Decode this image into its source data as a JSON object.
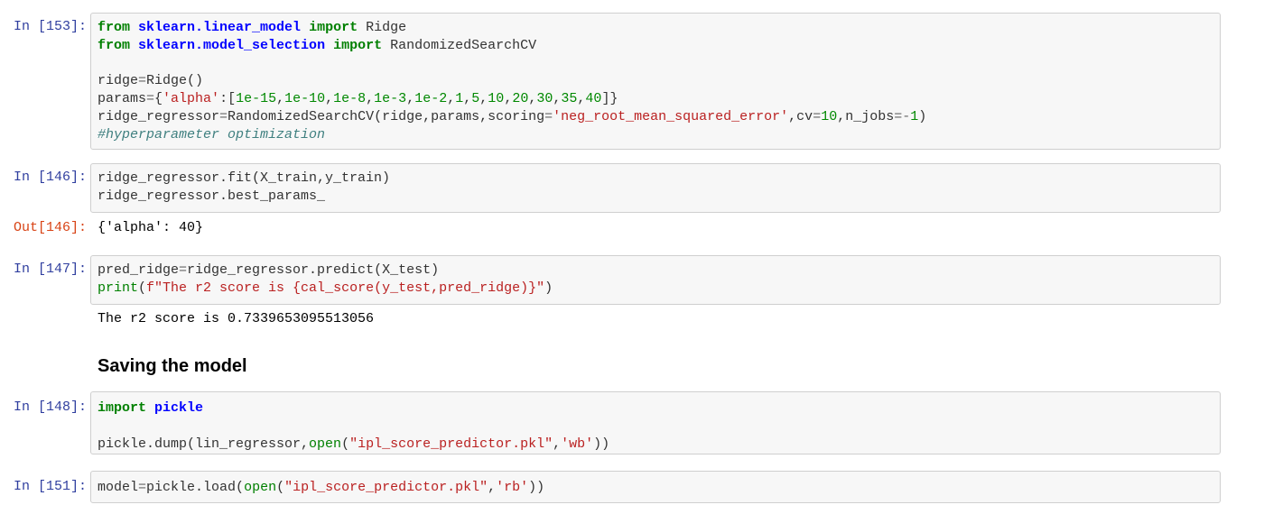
{
  "notebook": {
    "cells": [
      {
        "type": "code",
        "prompt": "In [153]:",
        "lines": [
          [
            {
              "t": "from",
              "c": "k"
            },
            {
              "t": " "
            },
            {
              "t": "sklearn.linear_model",
              "c": "nn"
            },
            {
              "t": " "
            },
            {
              "t": "import",
              "c": "k"
            },
            {
              "t": " Ridge"
            }
          ],
          [
            {
              "t": "from",
              "c": "k"
            },
            {
              "t": " "
            },
            {
              "t": "sklearn.model_selection",
              "c": "nn"
            },
            {
              "t": " "
            },
            {
              "t": "import",
              "c": "k"
            },
            {
              "t": " RandomizedSearchCV"
            }
          ],
          [],
          [
            {
              "t": "ridge"
            },
            {
              "t": "=",
              "c": "o"
            },
            {
              "t": "Ridge()"
            }
          ],
          [
            {
              "t": "params"
            },
            {
              "t": "=",
              "c": "o"
            },
            {
              "t": "{"
            },
            {
              "t": "'alpha'",
              "c": "s"
            },
            {
              "t": ":["
            },
            {
              "t": "1e-15",
              "c": "m"
            },
            {
              "t": ","
            },
            {
              "t": "1e-10",
              "c": "m"
            },
            {
              "t": ","
            },
            {
              "t": "1e-8",
              "c": "m"
            },
            {
              "t": ","
            },
            {
              "t": "1e-3",
              "c": "m"
            },
            {
              "t": ","
            },
            {
              "t": "1e-2",
              "c": "m"
            },
            {
              "t": ","
            },
            {
              "t": "1",
              "c": "m"
            },
            {
              "t": ","
            },
            {
              "t": "5",
              "c": "m"
            },
            {
              "t": ","
            },
            {
              "t": "10",
              "c": "m"
            },
            {
              "t": ","
            },
            {
              "t": "20",
              "c": "m"
            },
            {
              "t": ","
            },
            {
              "t": "30",
              "c": "m"
            },
            {
              "t": ","
            },
            {
              "t": "35",
              "c": "m"
            },
            {
              "t": ","
            },
            {
              "t": "40",
              "c": "m"
            },
            {
              "t": "]}"
            }
          ],
          [
            {
              "t": "ridge_regressor"
            },
            {
              "t": "=",
              "c": "o"
            },
            {
              "t": "RandomizedSearchCV(ridge,params,scoring"
            },
            {
              "t": "=",
              "c": "o"
            },
            {
              "t": "'neg_root_mean_squared_error'",
              "c": "s"
            },
            {
              "t": ",cv"
            },
            {
              "t": "=",
              "c": "o"
            },
            {
              "t": "10",
              "c": "m"
            },
            {
              "t": ",n_jobs"
            },
            {
              "t": "=-",
              "c": "o"
            },
            {
              "t": "1",
              "c": "m"
            },
            {
              "t": ")"
            }
          ],
          [
            {
              "t": "#hyperparameter optimization",
              "c": "c"
            }
          ]
        ]
      },
      {
        "type": "code",
        "prompt": "In [146]:",
        "lines": [
          [
            {
              "t": "ridge_regressor.fit(X_train,y_train)"
            }
          ],
          [
            {
              "t": "ridge_regressor.best_params_"
            }
          ]
        ],
        "output_prompt": "Out[146]:",
        "output": "{'alpha': 40}"
      },
      {
        "type": "code",
        "prompt": "In [147]:",
        "lines": [
          [
            {
              "t": "pred_ridge"
            },
            {
              "t": "=",
              "c": "o"
            },
            {
              "t": "ridge_regressor.predict(X_test)"
            }
          ],
          [
            {
              "t": "print",
              "c": "nb"
            },
            {
              "t": "("
            },
            {
              "t": "f\"The r2 score is {cal_score(y_test,pred_ridge)}\"",
              "c": "s"
            },
            {
              "t": ")"
            }
          ]
        ],
        "stdout": "The r2 score is 0.7339653095513056"
      },
      {
        "type": "markdown",
        "heading": "Saving the model"
      },
      {
        "type": "code",
        "prompt": "In [148]:",
        "lines": [
          [
            {
              "t": "import",
              "c": "k"
            },
            {
              "t": " "
            },
            {
              "t": "pickle",
              "c": "nn"
            }
          ],
          [],
          [
            {
              "t": "pickle.dump(lin_regressor,"
            },
            {
              "t": "open",
              "c": "nb"
            },
            {
              "t": "("
            },
            {
              "t": "\"ipl_score_predictor.pkl\"",
              "c": "s"
            },
            {
              "t": ","
            },
            {
              "t": "'wb'",
              "c": "s"
            },
            {
              "t": "))"
            }
          ]
        ]
      },
      {
        "type": "code",
        "prompt": "In [151]:",
        "lines": [
          [
            {
              "t": "model"
            },
            {
              "t": "=",
              "c": "o"
            },
            {
              "t": "pickle.load("
            },
            {
              "t": "open",
              "c": "nb"
            },
            {
              "t": "("
            },
            {
              "t": "\"ipl_score_predictor.pkl\"",
              "c": "s"
            },
            {
              "t": ","
            },
            {
              "t": "'rb'",
              "c": "s"
            },
            {
              "t": "))"
            }
          ]
        ]
      }
    ]
  }
}
